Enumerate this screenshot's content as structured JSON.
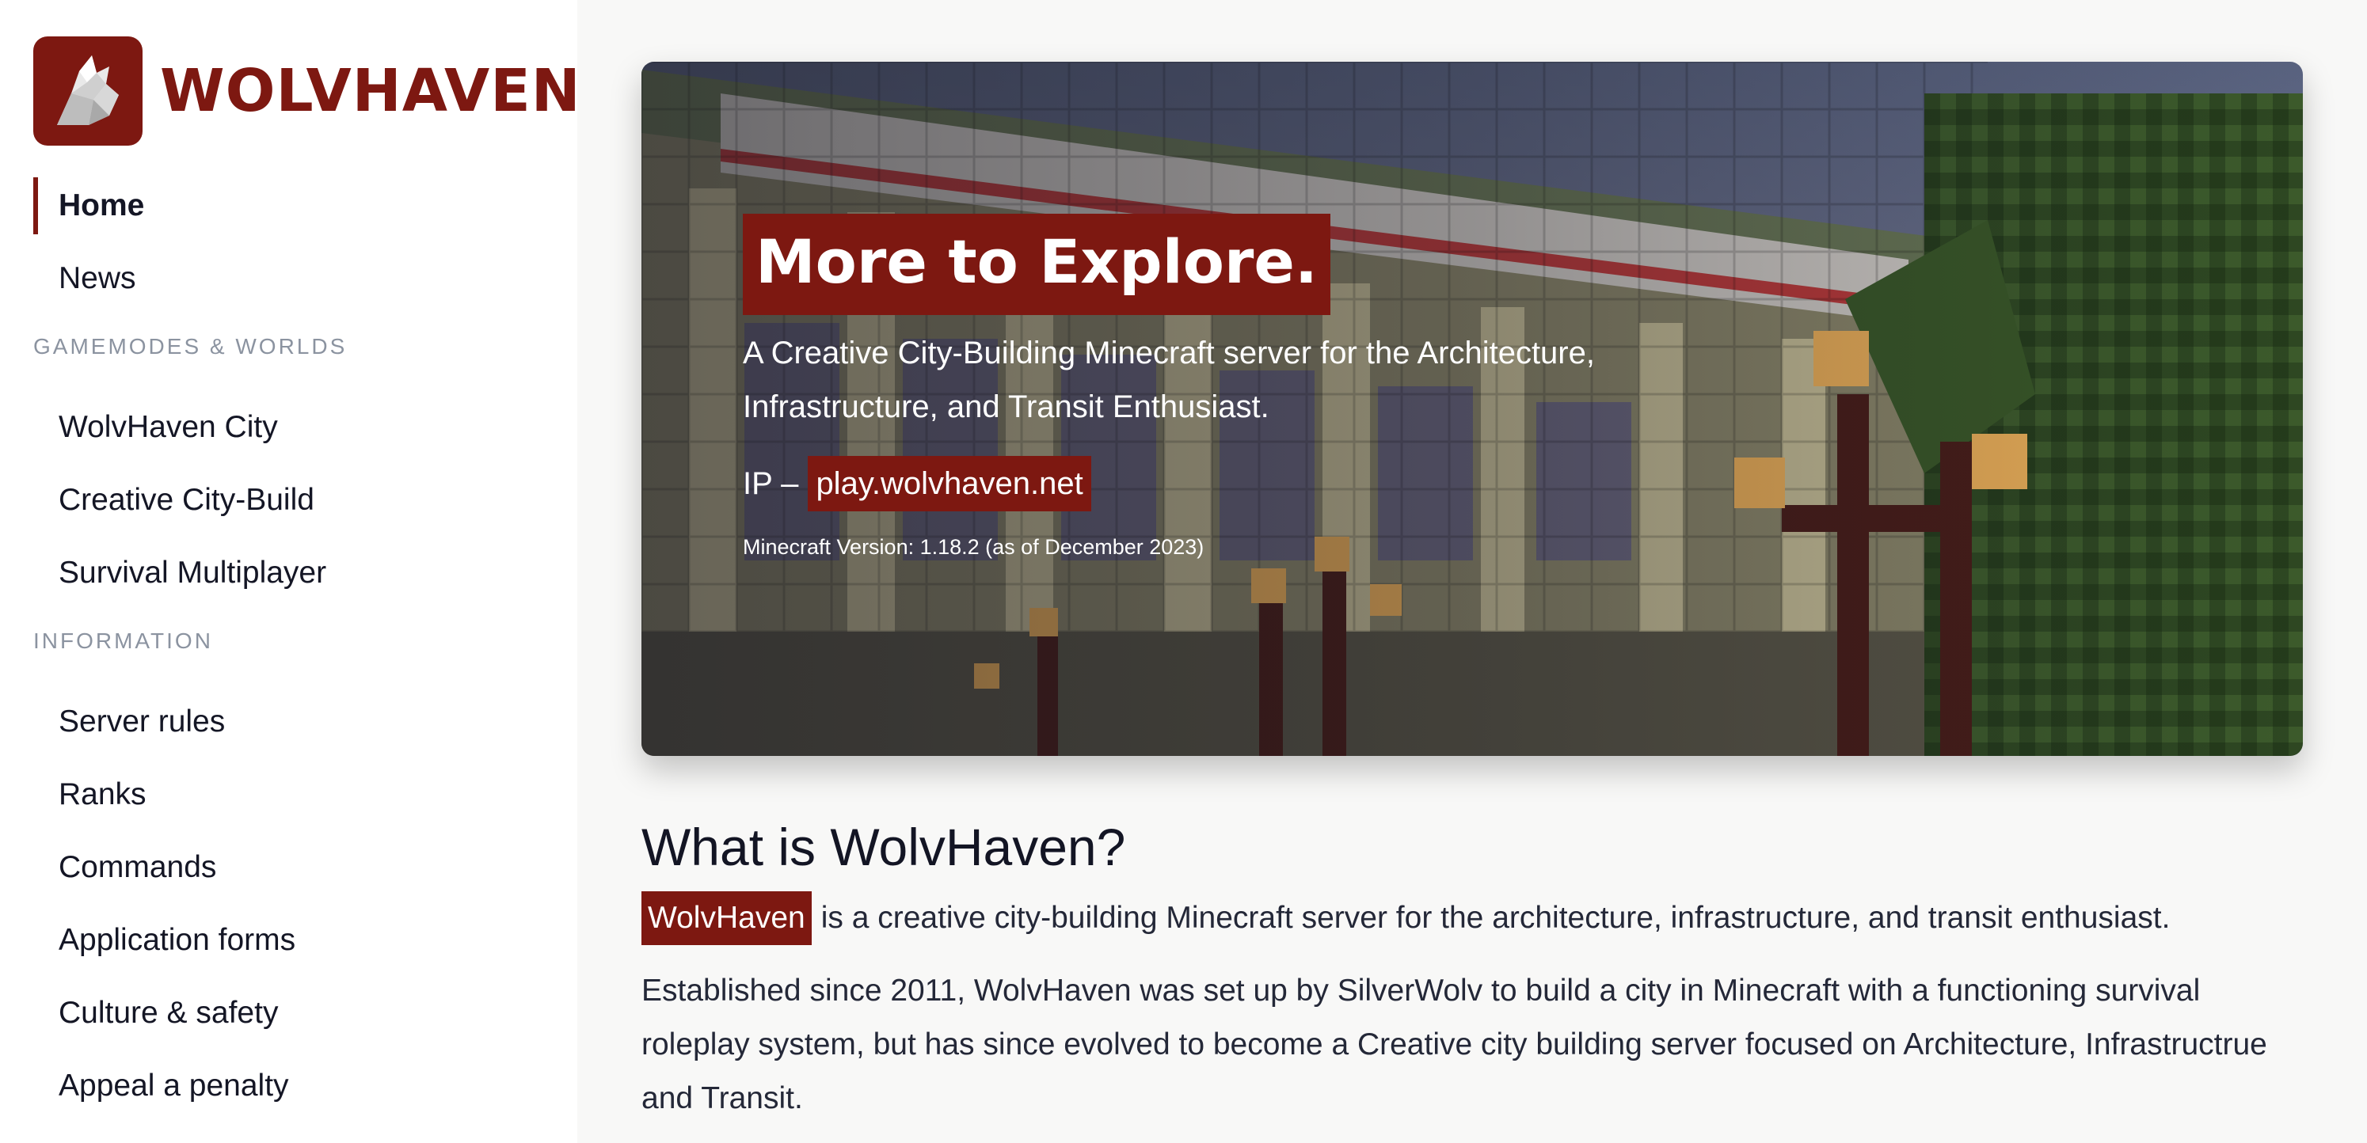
{
  "brand": {
    "name": "WOLVHAVEN",
    "logo_icon": "wolf-head-icon",
    "color": "#7d1811"
  },
  "sidebar": {
    "items_top": [
      {
        "label": "Home",
        "active": true
      },
      {
        "label": "News",
        "active": false
      }
    ],
    "section_gamemodes": {
      "title": "GAMEMODES & WORLDS",
      "items": [
        "WolvHaven City",
        "Creative City-Build",
        "Survival Multiplayer"
      ]
    },
    "section_information": {
      "title": "INFORMATION",
      "items": [
        "Server rules",
        "Ranks",
        "Commands",
        "Application forms",
        "Culture & safety",
        "Appeal a penalty"
      ]
    }
  },
  "hero": {
    "title": "More to Explore.",
    "subtitle": "A Creative City-Building Minecraft server for the Architecture, Infrastructure, and Transit Enthusiast.",
    "ip_label": "IP –",
    "ip_value": "play.wolvhaven.net",
    "version": "Minecraft Version: 1.18.2 (as of December 2023)"
  },
  "article": {
    "heading": "What is WolvHaven?",
    "p1_highlight": "WolvHaven",
    "p1_rest": "is a creative city-building Minecraft server for the architecture, infrastructure, and transit enthusiast.",
    "p2": "Established since 2011, WolvHaven was set up by SilverWolv to build a city in Minecraft with a functioning survival roleplay system, but has since evolved to become a Creative city building server focused on Architecture, Infrastructrue and Transit."
  }
}
